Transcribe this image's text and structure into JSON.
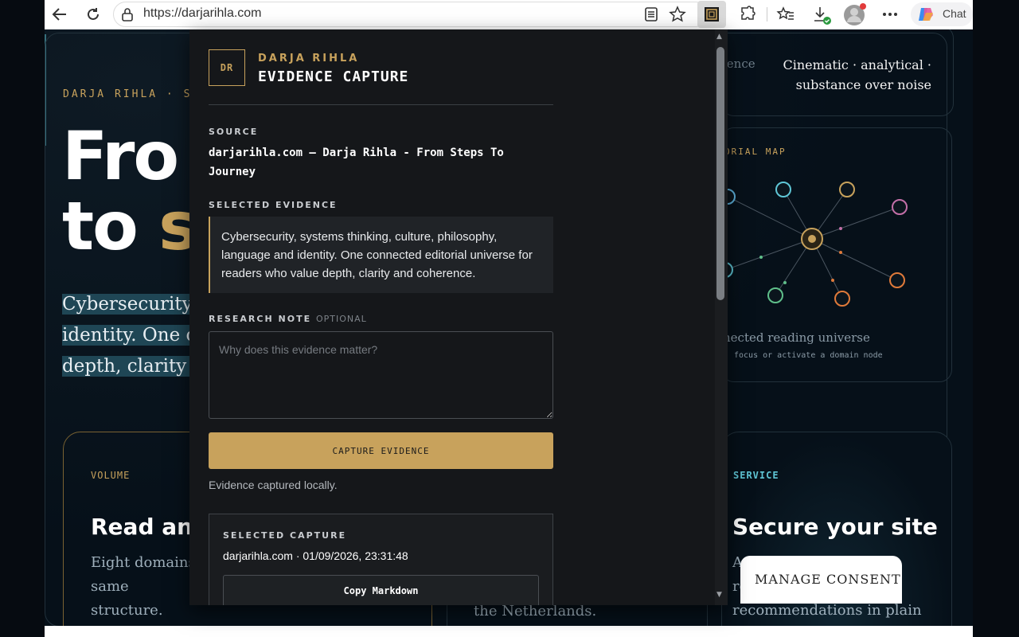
{
  "browser": {
    "url": "https://darjarihla.com",
    "chat_label": "Chat",
    "icons": [
      "back-icon",
      "refresh-icon",
      "lock-icon",
      "reader-icon",
      "star-icon",
      "extension-evidence-icon",
      "puzzle-icon",
      "favorites-icon",
      "download-icon",
      "profile-icon",
      "more-icon",
      "copilot-icon"
    ]
  },
  "page": {
    "kicker": "DARJA RIHLA · S",
    "hero_line1": "Fro",
    "hero_line2_white": "to ",
    "hero_line2_gold": "st",
    "hero_desc_lines": [
      "Cybersecurity,",
      "identity. One co",
      "depth, clarity a"
    ],
    "right_card_left": "ience",
    "right_card_right": "Cinematic · analytical · substance over noise",
    "map_kicker": "ORIAL MAP",
    "map_caption": "nected reading universe",
    "map_hint": "focus or activate a domain node",
    "volume_kicker": "VOLUME",
    "volume_title": "Read and",
    "volume_desc": "Eight domains, same structure.",
    "mid_desc": "the Netherlands.",
    "service_kicker": "SERVICE",
    "service_title": "Secure your site",
    "service_desc": "A practical WordPress review with clear recommendations in plain",
    "consent_label": "MANAGE CONSENT"
  },
  "popup": {
    "logo": "DR",
    "brand": "DARJA RIHLA",
    "title": "EVIDENCE CAPTURE",
    "source_label": "SOURCE",
    "source_value": "darjarihla.com — Darja Rihla - From Steps To Journey",
    "selected_label": "SELECTED EVIDENCE",
    "selected_text": "Cybersecurity, systems thinking, culture, philosophy, language and identity. One connected editorial universe for readers who value depth, clarity and coherence.",
    "note_label": "RESEARCH NOTE",
    "note_optional": "OPTIONAL",
    "note_placeholder": "Why does this evidence matter?",
    "note_value": "",
    "capture_button": "CAPTURE EVIDENCE",
    "status": "Evidence captured locally.",
    "selected_capture_label": "SELECTED CAPTURE",
    "selected_capture_meta": "darjarihla.com · 01/09/2026, 23:31:48",
    "copy_button": "Copy Markdown"
  },
  "colors": {
    "gold": "#c8a25c",
    "page_bg": "#061019",
    "popup_bg": "#15171a",
    "service_accent": "#5fc6d6"
  }
}
